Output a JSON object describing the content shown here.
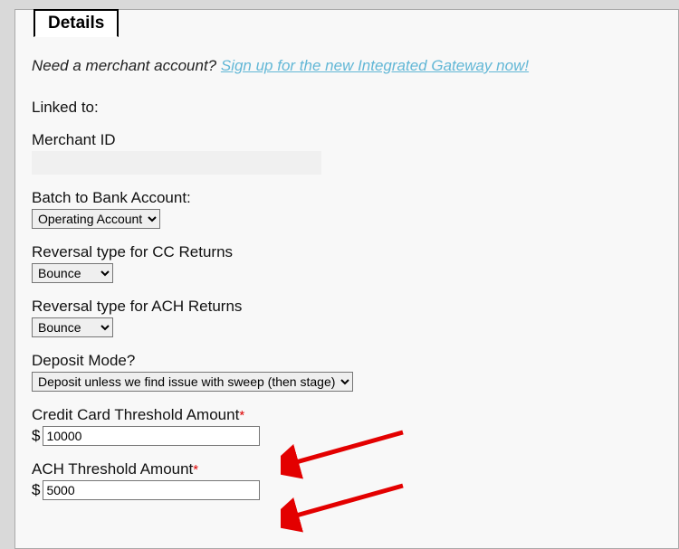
{
  "tab_label": "Details",
  "prompt": {
    "lead": "Need a merchant account? ",
    "link": "Sign up for the new Integrated Gateway now!"
  },
  "linked_to_label": "Linked to:",
  "merchant_id_label": "Merchant ID",
  "batch_label": "Batch to Bank Account:",
  "batch_value": "Operating Account",
  "reversal_cc_label": "Reversal type for CC Returns",
  "reversal_cc_value": "Bounce",
  "reversal_ach_label": "Reversal type for ACH Returns",
  "reversal_ach_value": "Bounce",
  "deposit_label": "Deposit Mode?",
  "deposit_value": "Deposit unless we find issue with sweep (then stage)",
  "cc_threshold_label": "Credit Card Threshold Amount",
  "cc_threshold_value": "10000",
  "ach_threshold_label": "ACH Threshold Amount",
  "ach_threshold_value": "5000",
  "currency_symbol": "$"
}
